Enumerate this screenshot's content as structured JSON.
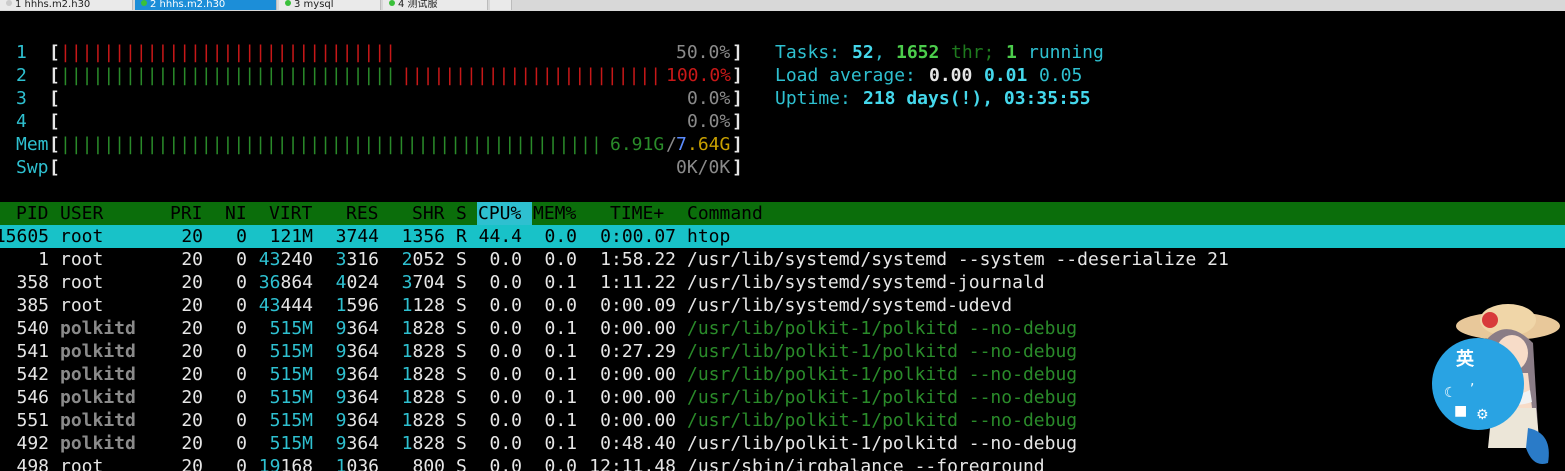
{
  "tabs": [
    {
      "label": "1 hhhs.m2.h30",
      "active": false
    },
    {
      "label": "2 hhhs.m2.h30",
      "active": true
    },
    {
      "label": "3 mysql",
      "active": false
    },
    {
      "label": "4 测试服",
      "active": false
    }
  ],
  "meters": {
    "cpu1": {
      "label": "1",
      "percent": 50.0,
      "text": "50.0%"
    },
    "cpu2": {
      "label": "2",
      "percent": 100.0,
      "text": "100.0%"
    },
    "cpu3": {
      "label": "3",
      "percent": 0.0,
      "text": "0.0%"
    },
    "cpu4": {
      "label": "4",
      "percent": 0.0,
      "text": "0.0%"
    },
    "mem": {
      "label": "Mem",
      "used": "6.91G",
      "sep": "/",
      "total_a": "7",
      "total_b": ".64G"
    },
    "swp": {
      "label": "Swp",
      "text": "0K/0K"
    }
  },
  "summary": {
    "tasks_label": "Tasks:",
    "tasks": "52",
    "threads": "1652",
    "thr_label": "thr;",
    "running": "1",
    "running_label": "running",
    "load_label": "Load average:",
    "load1": "0.00",
    "load5": "0.01",
    "load15": "0.05",
    "uptime_label": "Uptime:",
    "uptime": "218 days(!), 03:35:55"
  },
  "columns": {
    "pid": "PID",
    "user": "USER",
    "pri": "PRI",
    "ni": "NI",
    "virt": "VIRT",
    "res": "RES",
    "shr": "SHR",
    "s": "S",
    "cpu": "CPU%",
    "mem": "MEM%",
    "time": "TIME+",
    "command": "Command"
  },
  "processes": [
    {
      "pid": "15605",
      "user": "root",
      "pri": "20",
      "ni": "0",
      "virt": "121M",
      "res": "3744",
      "shr": "1356",
      "s": "R",
      "cpu": "44.4",
      "mem": "0.0",
      "time": "0:00.07",
      "command": "htop",
      "selected": true
    },
    {
      "pid": "1",
      "user": "root",
      "pri": "20",
      "ni": "0",
      "virt": "43240",
      "res": "3316",
      "shr": "2052",
      "s": "S",
      "cpu": "0.0",
      "mem": "0.0",
      "time": "1:58.22",
      "command": "/usr/lib/systemd/systemd --system --deserialize 21"
    },
    {
      "pid": "358",
      "user": "root",
      "pri": "20",
      "ni": "0",
      "virt": "36864",
      "res": "4024",
      "shr": "3704",
      "s": "S",
      "cpu": "0.0",
      "mem": "0.1",
      "time": "1:11.22",
      "command": "/usr/lib/systemd/systemd-journald"
    },
    {
      "pid": "385",
      "user": "root",
      "pri": "20",
      "ni": "0",
      "virt": "43444",
      "res": "1596",
      "shr": "1128",
      "s": "S",
      "cpu": "0.0",
      "mem": "0.0",
      "time": "0:00.09",
      "command": "/usr/lib/systemd/systemd-udevd"
    },
    {
      "pid": "540",
      "user": "polkitd",
      "pri": "20",
      "ni": "0",
      "virt": "515M",
      "res": "9364",
      "shr": "1828",
      "s": "S",
      "cpu": "0.0",
      "mem": "0.1",
      "time": "0:00.00",
      "command": "/usr/lib/polkit-1/polkitd --no-debug",
      "thread": true
    },
    {
      "pid": "541",
      "user": "polkitd",
      "pri": "20",
      "ni": "0",
      "virt": "515M",
      "res": "9364",
      "shr": "1828",
      "s": "S",
      "cpu": "0.0",
      "mem": "0.1",
      "time": "0:27.29",
      "command": "/usr/lib/polkit-1/polkitd --no-debug",
      "thread": true
    },
    {
      "pid": "542",
      "user": "polkitd",
      "pri": "20",
      "ni": "0",
      "virt": "515M",
      "res": "9364",
      "shr": "1828",
      "s": "S",
      "cpu": "0.0",
      "mem": "0.1",
      "time": "0:00.00",
      "command": "/usr/lib/polkit-1/polkitd --no-debug",
      "thread": true
    },
    {
      "pid": "546",
      "user": "polkitd",
      "pri": "20",
      "ni": "0",
      "virt": "515M",
      "res": "9364",
      "shr": "1828",
      "s": "S",
      "cpu": "0.0",
      "mem": "0.1",
      "time": "0:00.00",
      "command": "/usr/lib/polkit-1/polkitd --no-debug",
      "thread": true
    },
    {
      "pid": "551",
      "user": "polkitd",
      "pri": "20",
      "ni": "0",
      "virt": "515M",
      "res": "9364",
      "shr": "1828",
      "s": "S",
      "cpu": "0.0",
      "mem": "0.1",
      "time": "0:00.00",
      "command": "/usr/lib/polkit-1/polkitd --no-debug",
      "thread": true
    },
    {
      "pid": "492",
      "user": "polkitd",
      "pri": "20",
      "ni": "0",
      "virt": "515M",
      "res": "9364",
      "shr": "1828",
      "s": "S",
      "cpu": "0.0",
      "mem": "0.1",
      "time": "0:48.40",
      "command": "/usr/lib/polkit-1/polkitd --no-debug"
    },
    {
      "pid": "498",
      "user": "root",
      "pri": "20",
      "ni": "0",
      "virt": "19168",
      "res": "1036",
      "shr": "800",
      "s": "S",
      "cpu": "0.0",
      "mem": "0.0",
      "time": "12:11.48",
      "command": "/usr/sbin/irqbalance --foreground"
    }
  ],
  "ime_widget": {
    "char": "英",
    "icons": [
      "tshirt-icon",
      "gear-icon",
      "moon-icon",
      "comma-icon"
    ]
  },
  "colors": {
    "header_bg": "#0b6e0b",
    "selected_bg": "#18c2c8",
    "cpu_header_bg": "#2ec0d0",
    "meter_green": "#2a8b2a",
    "meter_red": "#c81818"
  }
}
